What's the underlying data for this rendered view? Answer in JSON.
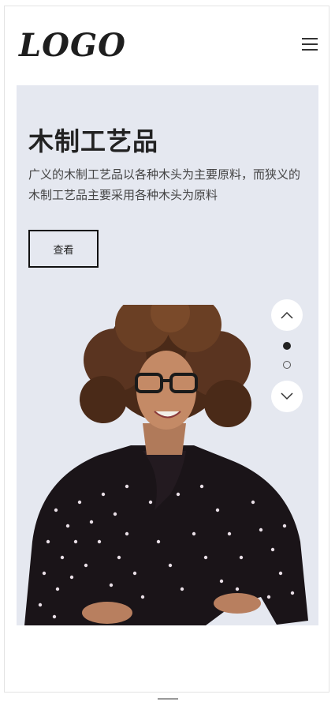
{
  "header": {
    "logo_text": "LOGO",
    "menu_icon": "hamburger-menu-icon"
  },
  "hero": {
    "title": "木制工艺品",
    "description": "广义的木制工艺品以各种木头为主要原料，而狭义的木制工艺品主要采用各种木头为原料",
    "view_button_label": "查看",
    "background_color": "#e5e8f0",
    "slider": {
      "prev_icon": "chevron-up-icon",
      "next_icon": "chevron-down-icon",
      "slide_count": 2,
      "active_index": 1
    }
  }
}
